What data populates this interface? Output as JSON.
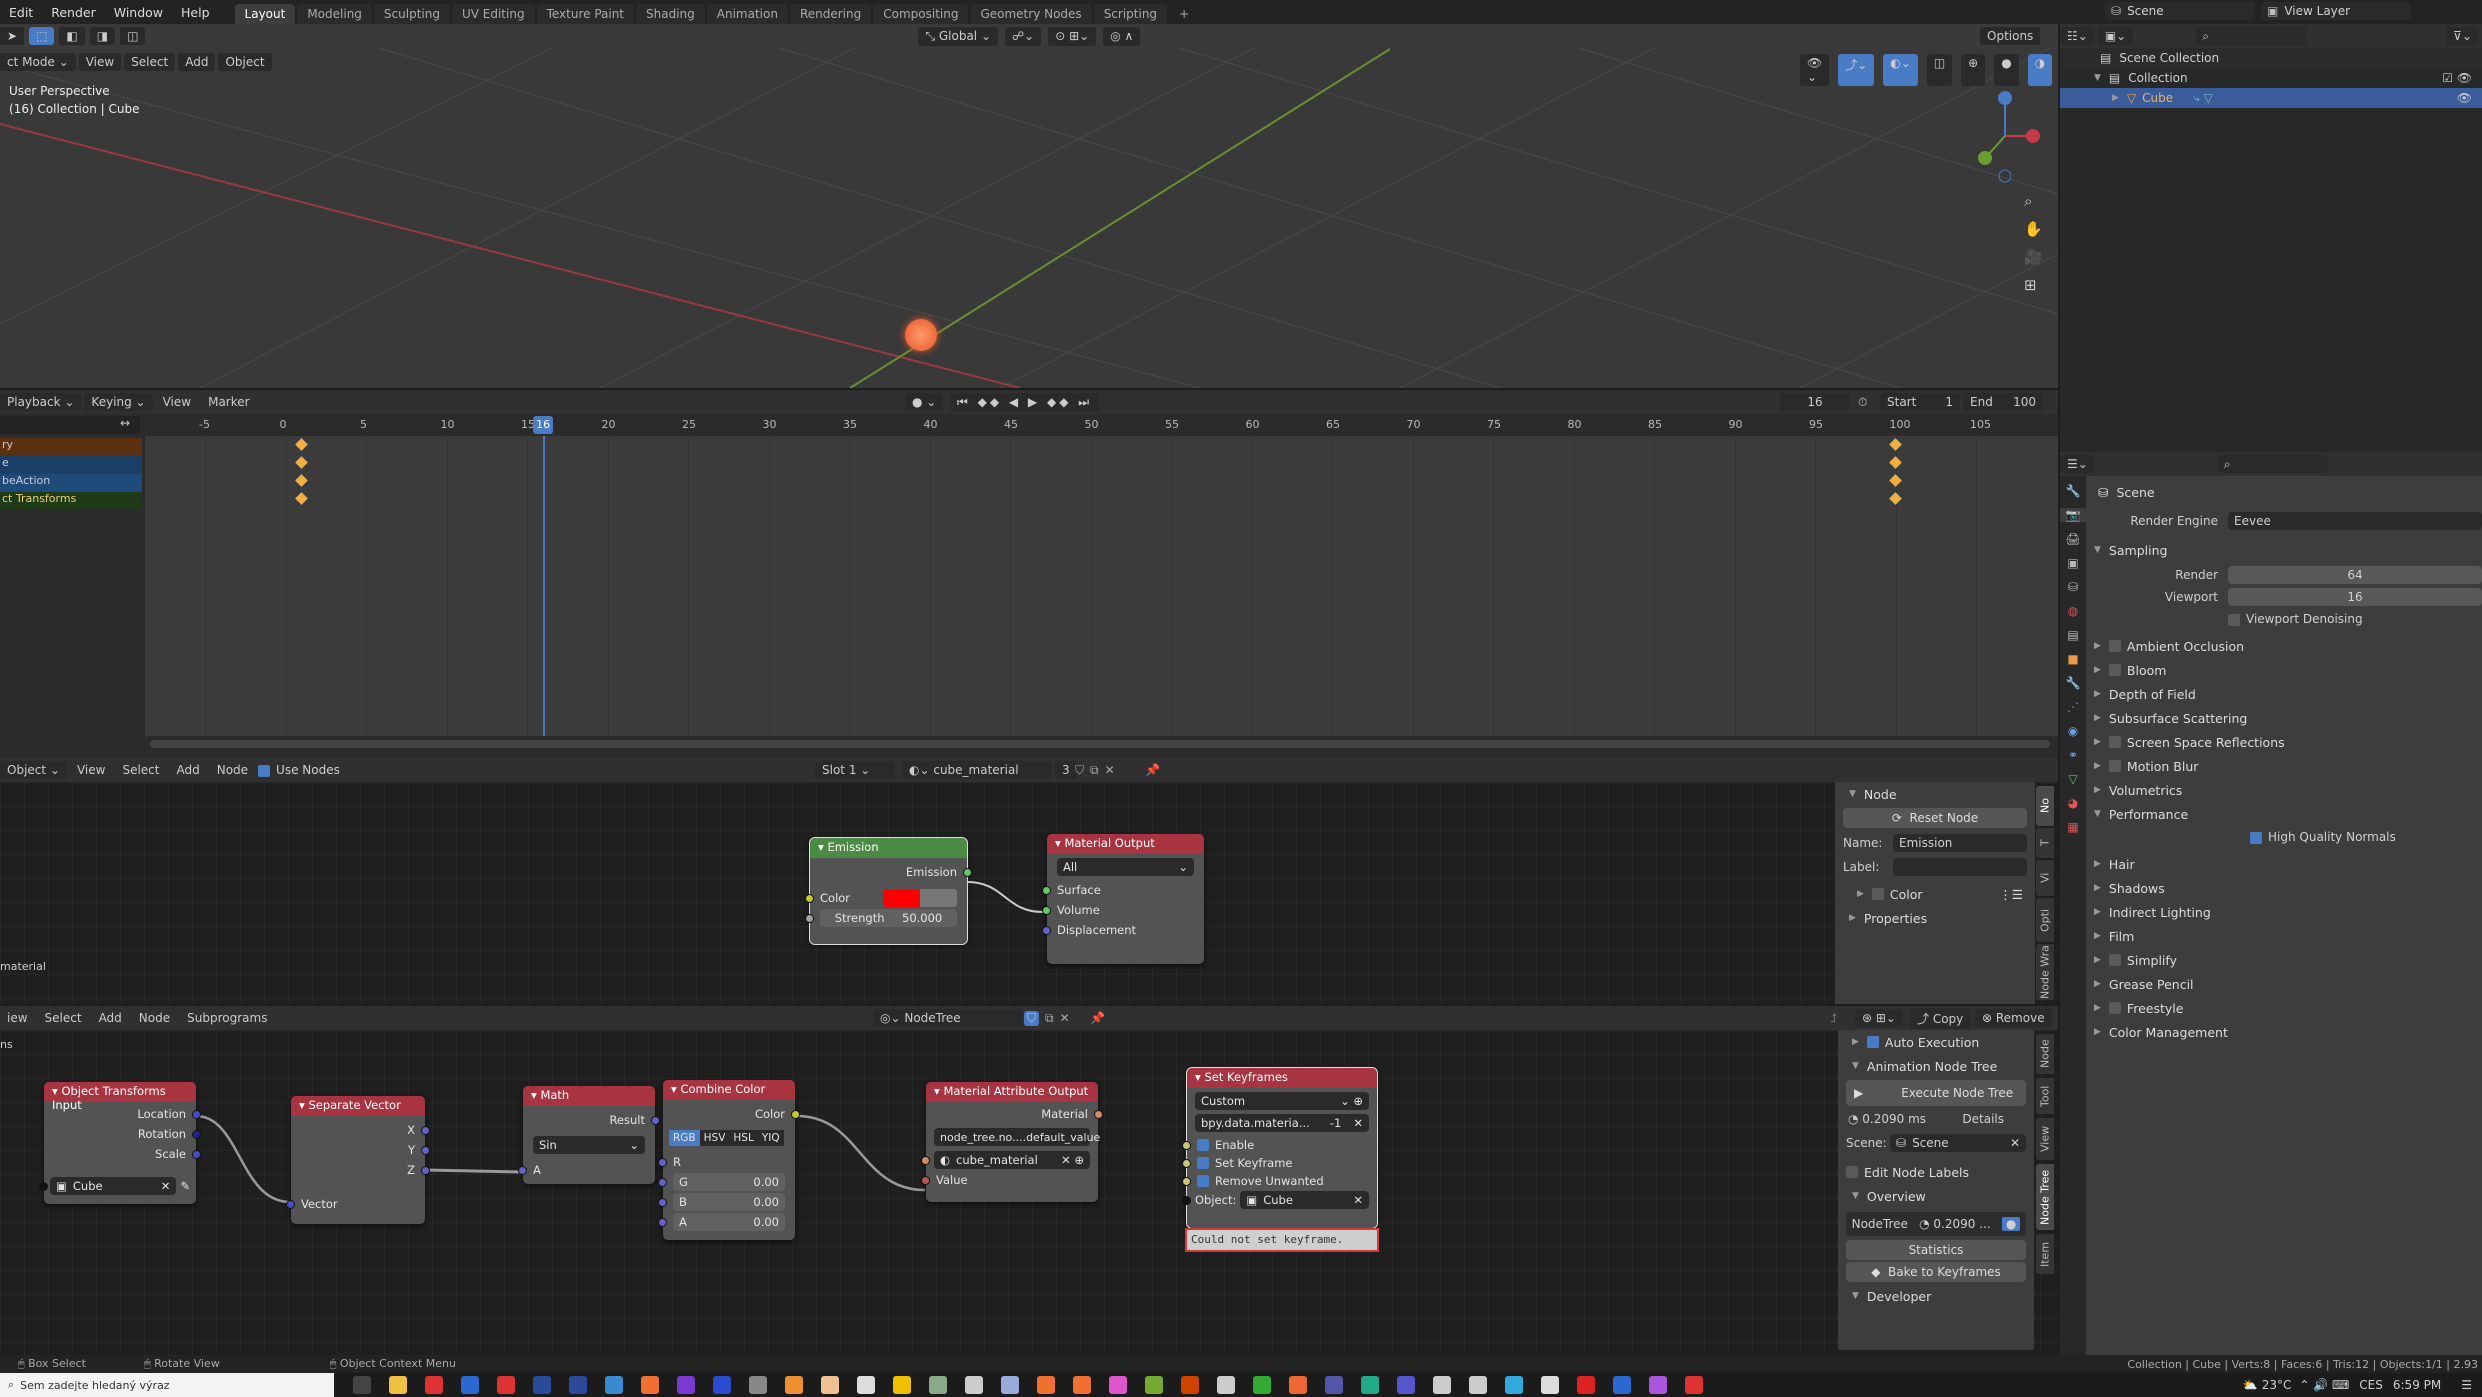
{
  "topbar": {
    "menus": [
      "Edit",
      "Render",
      "Window",
      "Help"
    ],
    "workspaces": [
      "Layout",
      "Modeling",
      "Sculpting",
      "UV Editing",
      "Texture Paint",
      "Shading",
      "Animation",
      "Rendering",
      "Compositing",
      "Geometry Nodes",
      "Scripting"
    ],
    "active_workspace": "Layout",
    "add_tab": "+",
    "scene": "Scene",
    "view_layer": "View Layer"
  },
  "viewport": {
    "mode": "ct Mode",
    "menus": [
      "View",
      "Select",
      "Add",
      "Object"
    ],
    "orientation": "Global",
    "options": "Options",
    "overlay_title": "User Perspective",
    "overlay_sub": "(16) Collection | Cube"
  },
  "timeline": {
    "menus": [
      "Playback",
      "Keying",
      "View",
      "Marker"
    ],
    "current_frame": "16",
    "start_label": "Start",
    "start": "1",
    "end_label": "End",
    "end": "100",
    "ticks": [
      "-5",
      "0",
      "5",
      "10",
      "15",
      "20",
      "25",
      "30",
      "35",
      "40",
      "45",
      "50",
      "55",
      "60",
      "65",
      "70",
      "75",
      "80",
      "85",
      "90",
      "95",
      "100",
      "105"
    ],
    "channels": [
      {
        "label": "ry",
        "color": "#5a3010"
      },
      {
        "label": "e",
        "color": "#1b3e66"
      },
      {
        "label": "beAction",
        "color": "#1f4b7a"
      },
      {
        "label": "ct Transforms",
        "color": "#1f3a16"
      }
    ],
    "keyframes": [
      1,
      100
    ]
  },
  "shader_editor": {
    "mode": "Object",
    "menus": [
      "View",
      "Select",
      "Add",
      "Node"
    ],
    "use_nodes": "Use Nodes",
    "slot": "Slot 1",
    "material": "cube_material",
    "users": "3",
    "side_label": "material",
    "emission": {
      "title": "Emission",
      "out": "Emission",
      "color": "Color",
      "strength_label": "Strength",
      "strength": "50.000",
      "color_value": "#ff0000"
    },
    "output": {
      "title": "Material Output",
      "target": "All",
      "inputs": [
        "Surface",
        "Volume",
        "Displacement"
      ]
    },
    "panel": {
      "title": "Node",
      "reset": "Reset Node",
      "name_label": "Name:",
      "name": "Emission",
      "label_label": "Label:",
      "label": "",
      "color": "Color",
      "properties": "Properties",
      "tabs": [
        "No",
        "T",
        "Vi",
        "Opti",
        "Node Wra"
      ]
    }
  },
  "anim_nodes": {
    "menus": [
      "iew",
      "Select",
      "Add",
      "Node",
      "Subprograms"
    ],
    "tree": "NodeTree",
    "copy": "Copy",
    "remove": "Remove",
    "side_label": "ns",
    "obj_input": {
      "title": "Object Transforms Input",
      "outputs": [
        "Location",
        "Rotation",
        "Scale"
      ],
      "object": "Cube"
    },
    "sep_vec": {
      "title": "Separate Vector",
      "outputs": [
        "X",
        "Y",
        "Z"
      ],
      "input": "Vector"
    },
    "math": {
      "title": "Math",
      "output": "Result",
      "op": "Sin",
      "input": "A"
    },
    "combine": {
      "title": "Combine Color",
      "output": "Color",
      "modes": [
        "RGB",
        "HSV",
        "HSL",
        "YIQ"
      ],
      "r": "R",
      "g_label": "G",
      "g": "0.00",
      "b_label": "B",
      "b": "0.00",
      "a_label": "A",
      "a": "0.00"
    },
    "mat_attr": {
      "title": "Material Attribute Output",
      "output": "Material",
      "path": "node_tree.no....default_value",
      "material": "cube_material",
      "input": "Value"
    },
    "set_key": {
      "title": "Set Keyframes",
      "mode": "Custom",
      "path": "bpy.data.materia...",
      "index": "-1",
      "enable": "Enable",
      "set_key": "Set Keyframe",
      "remove": "Remove Unwanted",
      "object_label": "Object:",
      "object": "Cube",
      "error": "Could not set keyframe."
    },
    "panel": {
      "auto_exec": "Auto Execution",
      "section": "Animation Node Tree",
      "execute": "Execute Node Tree",
      "time": "0.2090 ms",
      "details": "Details",
      "scene_label": "Scene:",
      "scene": "Scene",
      "edit_labels": "Edit Node Labels",
      "overview": "Overview",
      "tree_name": "NodeTree",
      "tree_time": "0.2090 ...",
      "statistics": "Statistics",
      "bake": "Bake to Keyframes",
      "developer": "Developer",
      "tabs": [
        "Node",
        "Tool",
        "View",
        "Node Tree",
        "Item"
      ]
    }
  },
  "outliner": {
    "items": [
      {
        "label": "Scene Collection"
      },
      {
        "label": "Collection"
      },
      {
        "label": "Cube"
      }
    ]
  },
  "properties": {
    "context": "Scene",
    "render_engine_label": "Render Engine",
    "render_engine": "Eevee",
    "sampling": "Sampling",
    "render_label": "Render",
    "render": "64",
    "viewport_label": "Viewport",
    "viewport": "16",
    "denoise": "Viewport Denoising",
    "sections": [
      {
        "label": "Ambient Occlusion",
        "cb": true
      },
      {
        "label": "Bloom",
        "cb": true
      },
      {
        "label": "Depth of Field",
        "cb": false
      },
      {
        "label": "Subsurface Scattering",
        "cb": false
      },
      {
        "label": "Screen Space Reflections",
        "cb": true
      },
      {
        "label": "Motion Blur",
        "cb": true
      },
      {
        "label": "Volumetrics",
        "cb": false
      }
    ],
    "performance": "Performance",
    "hq_normals": "High Quality Normals",
    "sections2": [
      {
        "label": "Hair",
        "cb": false
      },
      {
        "label": "Shadows",
        "cb": false
      },
      {
        "label": "Indirect Lighting",
        "cb": false
      },
      {
        "label": "Film",
        "cb": false
      },
      {
        "label": "Simplify",
        "cb": true
      },
      {
        "label": "Grease Pencil",
        "cb": false
      },
      {
        "label": "Freestyle",
        "cb": true
      },
      {
        "label": "Color Management",
        "cb": false
      }
    ]
  },
  "status": {
    "box_select": "Box Select",
    "rotate": "Rotate View",
    "context_menu": "Object Context Menu",
    "stats": "Collection | Cube | Verts:8 | Faces:6 | Tris:12 | Objects:1/1 | 2.93"
  },
  "taskbar": {
    "search": "Sem zadejte hledaný výraz",
    "temp": "23°C",
    "lang": "CES",
    "time": "6:59 PM"
  }
}
